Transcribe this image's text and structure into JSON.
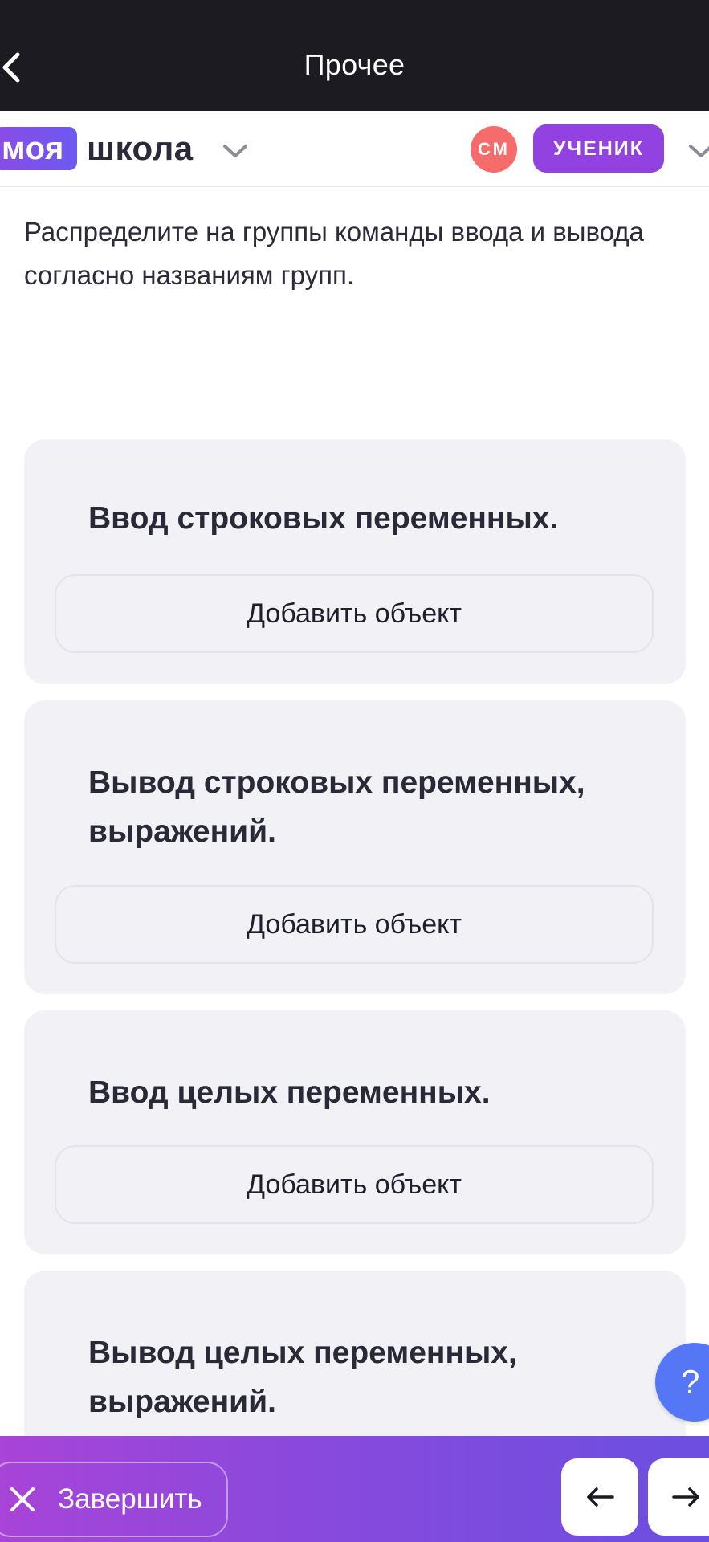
{
  "topbar": {
    "title": "Прочее"
  },
  "school_header": {
    "logo_part1": "моя",
    "logo_part2": "школа",
    "avatar_initials": "СМ",
    "role": "УЧЕНИК"
  },
  "instructions": "Распределите на группы команды ввода и вывода согласно названиям групп.",
  "groups": [
    {
      "title": "Ввод строковых переменных.",
      "add_label": "Добавить объект"
    },
    {
      "title": "Вывод строковых переменных, выражений.",
      "add_label": "Добавить объект"
    },
    {
      "title": "Ввод целых переменных.",
      "add_label": "Добавить объект"
    },
    {
      "title": "Вывод целых переменных, выражений."
    }
  ],
  "help": {
    "label": "?"
  },
  "bottombar": {
    "finish_label": "Завершить"
  },
  "icons": {
    "back": "chevron-left-icon",
    "school_dropdown": "chevron-down-icon",
    "role_dropdown": "chevron-down-icon",
    "finish": "close-icon",
    "prev": "arrow-left-icon",
    "next": "arrow-right-icon"
  },
  "colors": {
    "topbar_bg": "#1c1b22",
    "accent_purple": "#9142e0",
    "avatar_bg": "#f66b6b",
    "card_bg": "#f2f2f6",
    "help_bg": "#5677f5",
    "bottombar_gradient_start": "#a844d8",
    "bottombar_gradient_end": "#6b4fe0"
  }
}
